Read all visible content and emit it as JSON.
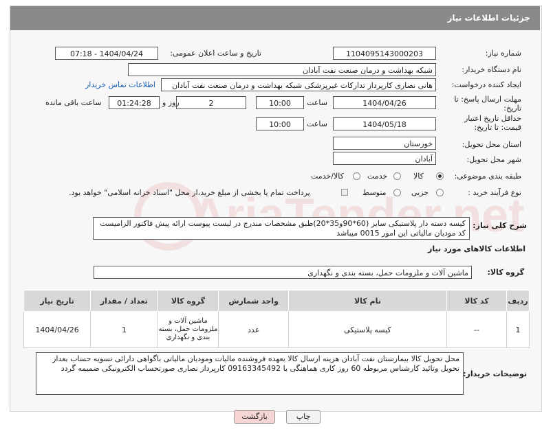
{
  "header": {
    "title": "جزئیات اطلاعات نیاز"
  },
  "fields": {
    "need_number_label": "شماره نیاز:",
    "need_number": "1104095143000203",
    "announce_label": "تاریخ و ساعت اعلان عمومی:",
    "announce_value": "1404/04/24 - 07:18",
    "buyer_org_label": "نام دستگاه خریدار:",
    "buyer_org": "شبکه بهداشت و درمان صنعت نفت آبادان",
    "creator_label": "ایجاد کننده درخواست:",
    "creator": "هانی نصاری کارپرداز تدارکات غیرپزشکی شبکه بهداشت و درمان صنعت نفت آبادان",
    "contact_link": "اطلاعات تماس خریدار",
    "reply_deadline_label": "مهلت ارسال پاسخ: تا تاریخ:",
    "reply_date": "1404/04/26",
    "time_label": "ساعت",
    "reply_time": "10:00",
    "days_value": "2",
    "days_label": "روز و",
    "remaining_time": "01:24:28",
    "remaining_label": "ساعت باقی مانده",
    "price_validity_label": "حداقل تاریخ اعتبار قیمت: تا تاریخ:",
    "price_date": "1404/05/18",
    "price_time": "10:00",
    "province_label": "استان محل تحویل:",
    "province": "خوزستان",
    "city_label": "شهر محل تحویل:",
    "city": "آبادان",
    "category_label": "طبقه بندی موضوعی:",
    "category_options": [
      "کالا",
      "خدمت",
      "کالا/خدمت"
    ],
    "process_label": "نوع فرآیند خرید :",
    "process_options": [
      "جزیی",
      "متوسط"
    ],
    "process_note": "پرداخت تمام یا بخشی از مبلغ خرید،از محل \"اسناد خزانه اسلامی\" خواهد بود."
  },
  "description": {
    "label": "شرح کلی نیاز:",
    "text": "کیسه دسته دار پلاستیکی سایز (60*90و35*20)طبق مشخصات مندرج در لیست پیوست ارائه پیش فاکتور الزامیست کد مودیان مالیاتی این امور 0015 میباشد"
  },
  "goods_section": {
    "title": "اطلاعات کالاهای مورد نیاز",
    "group_label": "گروه کالا:",
    "group_value": "ماشین آلات و ملزومات حمل، بسته بندی و نگهداری"
  },
  "table": {
    "headers": [
      "ردیف",
      "کد کالا",
      "نام کالا",
      "واحد شمارش",
      "گروه کالا",
      "تعداد / مقدار",
      "تاریخ نیاز"
    ],
    "rows": [
      [
        "1",
        "--",
        "کیسه پلاستیکی",
        "عدد",
        "ماشین آلات و ملزومات حمل، بسته بندی و نگهداری",
        "1",
        "1404/04/26"
      ]
    ]
  },
  "buyer_notes": {
    "label": "توضیحات خریدار:",
    "text": "محل تحویل کالا بیمارستان نفت آبادان هزینه ارسال کالا بعهده فروشنده مالیات ومودیان مالیاتی باگواهی دارائی تسویه حساب بعداز تحویل وتائید کارشناس مربوطه 60 روز کاری هماهنگی با 09163345492 کارپرداز نصاری صورتحساب الکترونیکی ضمیمه گردد"
  },
  "buttons": {
    "print": "چاپ",
    "back": "بازگشت"
  },
  "colors": {
    "header_bg": "#8a8a8a",
    "link": "#1a5fb4",
    "back_btn_bg": "#f6d5d5"
  }
}
